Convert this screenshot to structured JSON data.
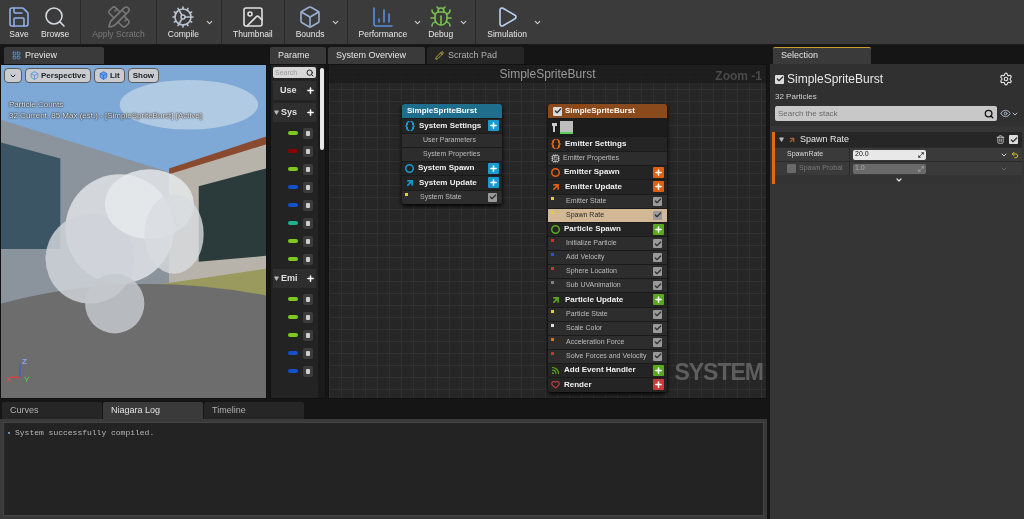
{
  "toolbar": [
    [
      {
        "label": "Save",
        "kind": "save",
        "disabled": false,
        "dropdown": false
      },
      {
        "label": "Browse",
        "kind": "browse",
        "disabled": false,
        "dropdown": false
      }
    ],
    [
      {
        "label": "Apply Scratch",
        "kind": "scratch",
        "disabled": true,
        "dropdown": false
      }
    ],
    [
      {
        "label": "Compile",
        "kind": "compile",
        "disabled": false,
        "dropdown": true
      }
    ],
    [
      {
        "label": "Thumbnail",
        "kind": "thumbnail",
        "disabled": false,
        "dropdown": false
      }
    ],
    [
      {
        "label": "Bounds",
        "kind": "bounds",
        "disabled": false,
        "dropdown": true
      }
    ],
    [
      {
        "label": "Performance",
        "kind": "performance",
        "disabled": false,
        "dropdown": true
      },
      {
        "label": "Debug",
        "kind": "debug",
        "disabled": false,
        "dropdown": true
      }
    ],
    [
      {
        "label": "Simulation",
        "kind": "simulation",
        "disabled": false,
        "dropdown": true
      }
    ]
  ],
  "preview": {
    "tab": {
      "label": "Preview",
      "selected": true
    },
    "toolbar": [
      {
        "kind": "menu"
      },
      {
        "kind": "perspective",
        "label": "Perspective"
      },
      {
        "kind": "lit",
        "label": "Lit"
      },
      {
        "kind": "plain",
        "label": "Show"
      }
    ],
    "overlay": [
      "Particle Counts",
      "32 Current, 85 Max (est.) - [SimpleSpriteBurst] [Active]"
    ],
    "axes": [
      "Z",
      "X",
      "Y"
    ]
  },
  "parameters": {
    "tab": {
      "label": "Parame",
      "selected": true
    },
    "search": {
      "placeholder": "Search"
    },
    "sections": [
      {
        "label": "Use",
        "expandable": false
      },
      {
        "label": "Sys",
        "expandable": true,
        "pins": [
          {
            "color": "#7ec820"
          },
          {
            "color": "#8a0000"
          },
          {
            "color": "#7ec820"
          },
          {
            "color": "#1450c8"
          },
          {
            "color": "#1450c8"
          },
          {
            "color": "#20b090"
          },
          {
            "color": "#7ec820"
          },
          {
            "color": "#7ec820"
          }
        ]
      },
      {
        "label": "Emi",
        "expandable": true,
        "pins": [
          {
            "color": "#7ec820"
          },
          {
            "color": "#7ec820"
          },
          {
            "color": "#7ec820"
          },
          {
            "color": "#1450c8"
          },
          {
            "color": "#1450c8"
          }
        ]
      }
    ]
  },
  "graph": {
    "tabs": [
      {
        "label": "System Overview",
        "kind": "plain",
        "selected": true
      },
      {
        "label": "Scratch Pad",
        "kind": "pencil",
        "selected": false
      }
    ],
    "title": "SimpleSpriteBurst",
    "zoom": "Zoom -1",
    "watermark": "SYSTEM",
    "nodes": [
      {
        "title": "SimpleSpriteBurst",
        "kind": "system",
        "rows": [
          {
            "kind": "settings",
            "label": "System Settings",
            "color": "#1a9ad0",
            "add_button": true
          },
          {
            "kind": "property",
            "label": "User Parameters"
          },
          {
            "kind": "property",
            "label": "System Properties"
          },
          {
            "kind": "spawn",
            "label": "System Spawn",
            "color": "#1a9ad0",
            "add_button": true
          },
          {
            "kind": "update",
            "label": "System Update",
            "color": "#1a9ad0",
            "add_button": true
          },
          {
            "kind": "module",
            "label": "System State",
            "color": "#e0d030",
            "checked": true,
            "selected": false
          }
        ]
      },
      {
        "title": "SimpleSpriteBurst",
        "kind": "emitter",
        "checked": true,
        "rows": [
          {
            "kind": "settings",
            "label": "Emitter Settings",
            "color": "#e06010",
            "add_button": false
          },
          {
            "kind": "cpu",
            "label": "Emitter Properties"
          },
          {
            "kind": "spawn",
            "label": "Emitter Spawn",
            "color": "#e06010",
            "add_button": true
          },
          {
            "kind": "update",
            "label": "Emitter Update",
            "color": "#e06010",
            "add_button": true
          },
          {
            "kind": "module",
            "label": "Emitter State",
            "color": "#e0d030",
            "checked": true,
            "selected": false
          },
          {
            "kind": "module",
            "label": "Spawn Rate",
            "color": "#e0d030",
            "checked": true,
            "selected": true
          },
          {
            "kind": "spawn",
            "label": "Particle Spawn",
            "color": "#5aa81e",
            "add_button": true
          },
          {
            "kind": "module",
            "label": "Initialize Particle",
            "color": "#d03030",
            "checked": true,
            "selected": false
          },
          {
            "kind": "module",
            "label": "Add Velocity",
            "color": "#3050d0",
            "checked": true,
            "selected": false
          },
          {
            "kind": "module",
            "label": "Sphere Location",
            "color": "#d03030",
            "checked": true,
            "selected": false
          },
          {
            "kind": "module",
            "label": "Sub UVAnimation",
            "color": "#808080",
            "checked": true,
            "selected": false
          },
          {
            "kind": "update",
            "label": "Particle Update",
            "color": "#5aa81e",
            "add_button": true
          },
          {
            "kind": "module",
            "label": "Particle State",
            "color": "#e0d030",
            "checked": true,
            "selected": false
          },
          {
            "kind": "module",
            "label": "Scale Color",
            "color": "#e0e0e0",
            "checked": true,
            "selected": false
          },
          {
            "kind": "module",
            "label": "Acceleration Force",
            "color": "#e07010",
            "checked": true,
            "selected": false
          },
          {
            "kind": "module",
            "label": "Solve Forces and Velocity",
            "color": "#d03030",
            "checked": true,
            "selected": false
          },
          {
            "kind": "event",
            "label": "Add Event Handler",
            "color": "#5aa81e",
            "add_button": true
          },
          {
            "kind": "render",
            "label": "Render",
            "color": "#c83c3c",
            "add_button": true
          }
        ]
      }
    ]
  },
  "selection": {
    "tab": {
      "label": "Selection",
      "selected": true
    },
    "checked": true,
    "title": "SimpleSpriteBurst",
    "subtitle": "32 Particles",
    "search": {
      "placeholder": "Search the stack"
    },
    "module": {
      "label": "Spawn Rate",
      "enabled": true,
      "properties": [
        {
          "kind": "plain",
          "label": "SpawnRate",
          "value": "20.0",
          "disabled": false
        },
        {
          "kind": "optional",
          "label": "Spawn Probal",
          "value": "1.0",
          "disabled": true,
          "checked": false
        }
      ]
    }
  },
  "bottom": {
    "tabs": [
      {
        "label": "Curves",
        "selected": false
      },
      {
        "label": "Niagara Log",
        "selected": true
      },
      {
        "label": "Timeline",
        "selected": false
      }
    ],
    "log": [
      "System successfully compiled."
    ]
  }
}
